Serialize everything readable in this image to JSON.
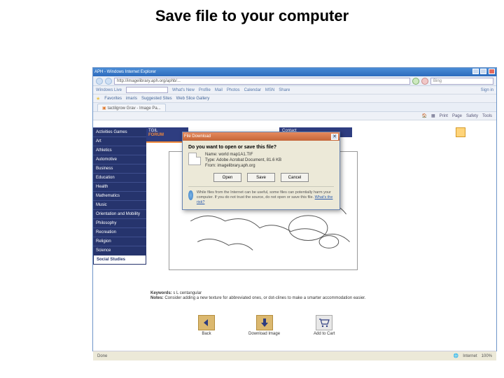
{
  "slide": {
    "title": "Save file to your computer"
  },
  "window": {
    "title": "APH - Windows Internet Explorer",
    "min": "_",
    "max": "▢",
    "close": "✕"
  },
  "addressbar": {
    "url": "http://imagelibrary.aph.org/aphb/...",
    "search_placeholder": "Bing"
  },
  "favbar": {
    "favorites": "Favorites",
    "tab1": "imaris",
    "tab2": "Suggested Sites",
    "tab3": "Web Slice Gallery",
    "signin": "Sign in"
  },
  "livebar": {
    "live": "Windows Live",
    "label": "Bing"
  },
  "tabs": {
    "active": "tactilgrow Grav - Image Pa..."
  },
  "cmdbar": {
    "home": "Home",
    "feeds": "Feeds",
    "print": "Print",
    "page": "Page",
    "safety": "Safety",
    "tools": "Tools"
  },
  "sidenav": {
    "items": [
      "Activities Games",
      "Art",
      "Athletics",
      "Automotive",
      "Business",
      "Education",
      "Health",
      "Mathematics",
      "Music",
      "Orientation and Mobility",
      "Philosophy",
      "Recreation",
      "Religion",
      "Science"
    ],
    "last": "Social Studies"
  },
  "banner": {
    "logo_line1": "TGIL",
    "logo_line2": "FORUM",
    "contact": "Contact"
  },
  "meta": {
    "keywords_label": "Keywords:",
    "keywords": "s L centangular",
    "notes_label": "Notes:",
    "notes": "Consider adding a new texture for abbreviated ones, or dot-clines to make a smarter accommodation easier."
  },
  "bottom": {
    "back": "Back",
    "download": "Download Image",
    "cart": "Add to Cart"
  },
  "statusbar": {
    "done": "Done",
    "zone": "Internet",
    "zoom": "100%"
  },
  "dialog": {
    "title": "File Download",
    "question": "Do you want to open or save this file?",
    "name_label": "Name:",
    "name_value": "world map1A1.TIF",
    "type_label": "Type:",
    "type_value": "Adobe Acrobat Document, 81.6 KB",
    "from_label": "From:",
    "from_value": "imagelibrary.aph.org",
    "open": "Open",
    "save": "Save",
    "cancel": "Cancel",
    "warning": "While files from the Internet can be useful, some files can potentially harm your computer. If you do not trust the source, do not open or save this file.",
    "risk_link": "What's the risk?"
  }
}
